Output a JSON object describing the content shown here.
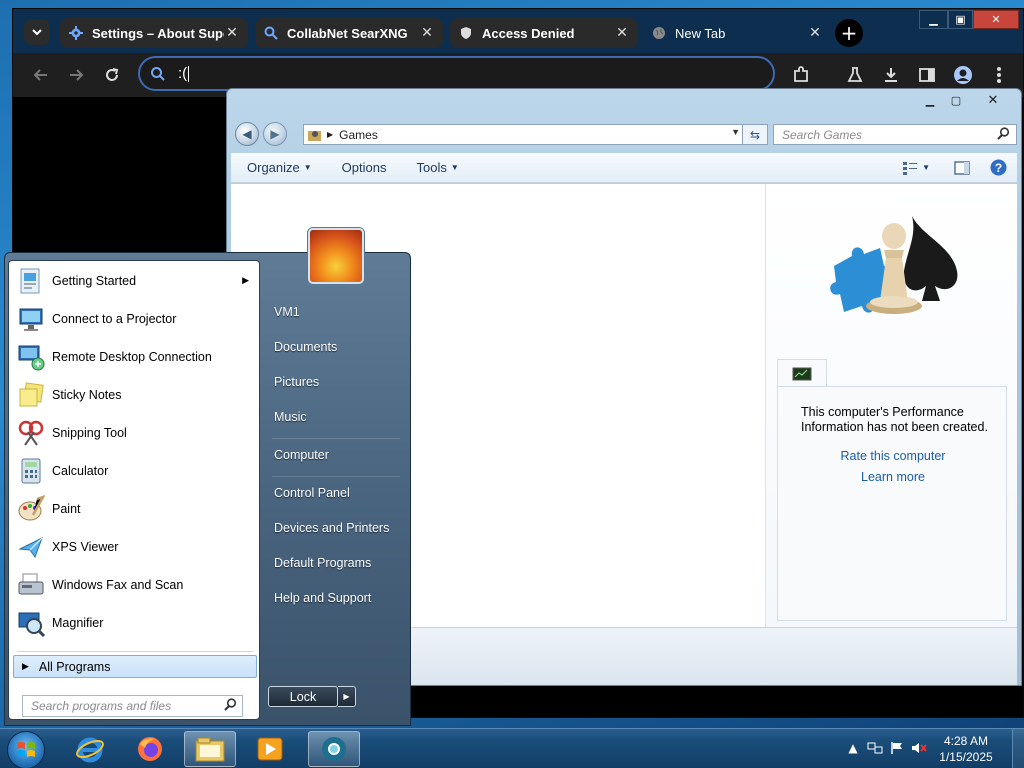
{
  "browser": {
    "tabs": [
      {
        "title": "Settings – About Super",
        "icon": "gear-icon",
        "active": false
      },
      {
        "title": "CollabNet SearXNG",
        "icon": "search-icon",
        "active": false
      },
      {
        "title": "Access Denied",
        "icon": "shield-icon",
        "active": false
      },
      {
        "title": "New Tab",
        "icon": "globe-icon",
        "active": true
      }
    ],
    "omnibox_value": ":(",
    "colors": {
      "tabstrip": "#0e2e4f",
      "omnibox_border": "#3d6bb3"
    }
  },
  "explorer": {
    "address_crumb": "Games",
    "search_placeholder": "Search Games",
    "commands": {
      "organize": "Organize",
      "options": "Options",
      "tools": "Tools"
    },
    "perf_message": "This computer's Performance Information has not been created.",
    "rate_link": "Rate this computer",
    "learn_link": "Learn more"
  },
  "startmenu": {
    "programs": [
      {
        "label": "Getting Started",
        "icon": "getting-started-icon",
        "submenu": true
      },
      {
        "label": "Connect to a Projector",
        "icon": "projector-icon"
      },
      {
        "label": "Remote Desktop Connection",
        "icon": "remote-desktop-icon"
      },
      {
        "label": "Sticky Notes",
        "icon": "sticky-notes-icon"
      },
      {
        "label": "Snipping Tool",
        "icon": "snipping-tool-icon"
      },
      {
        "label": "Calculator",
        "icon": "calculator-icon"
      },
      {
        "label": "Paint",
        "icon": "paint-icon"
      },
      {
        "label": "XPS Viewer",
        "icon": "xps-viewer-icon"
      },
      {
        "label": "Windows Fax and Scan",
        "icon": "fax-scan-icon"
      },
      {
        "label": "Magnifier",
        "icon": "magnifier-icon"
      }
    ],
    "all_programs": "All Programs",
    "search_placeholder": "Search programs and files",
    "right_links": {
      "user": "VM1",
      "documents": "Documents",
      "pictures": "Pictures",
      "music": "Music",
      "computer": "Computer",
      "control_panel": "Control Panel",
      "devices": "Devices and Printers",
      "default_programs": "Default Programs",
      "help": "Help and Support"
    },
    "lock_label": "Lock"
  },
  "taskbar": {
    "apps": [
      "internet-explorer-icon",
      "firefox-icon",
      "file-explorer-icon",
      "media-player-icon",
      "chrome-icon"
    ],
    "time": "4:28 AM",
    "date": "1/15/2025"
  }
}
